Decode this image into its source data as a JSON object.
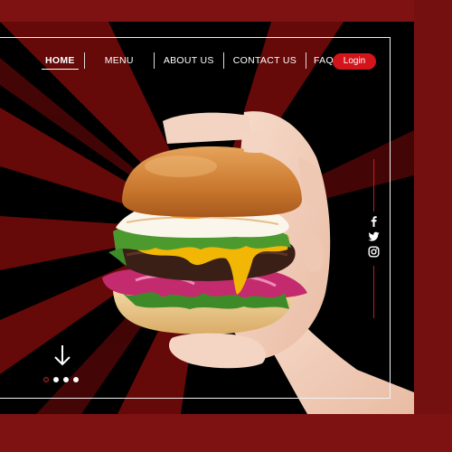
{
  "nav": {
    "items": [
      {
        "label": "HOME",
        "active": true
      },
      {
        "label": "MENU",
        "active": false
      },
      {
        "label": "ABOUT US",
        "active": false
      },
      {
        "label": "CONTACT US",
        "active": false
      },
      {
        "label": "FAQ",
        "active": false
      }
    ],
    "login_label": "Login"
  },
  "social": {
    "icons": [
      "facebook-icon",
      "twitter-icon",
      "instagram-icon"
    ]
  },
  "slider": {
    "total_slides": 4,
    "active_slide": 1
  },
  "theme": {
    "accent": "#d4141b",
    "background": "#050505",
    "maroon": "#7e1212"
  }
}
